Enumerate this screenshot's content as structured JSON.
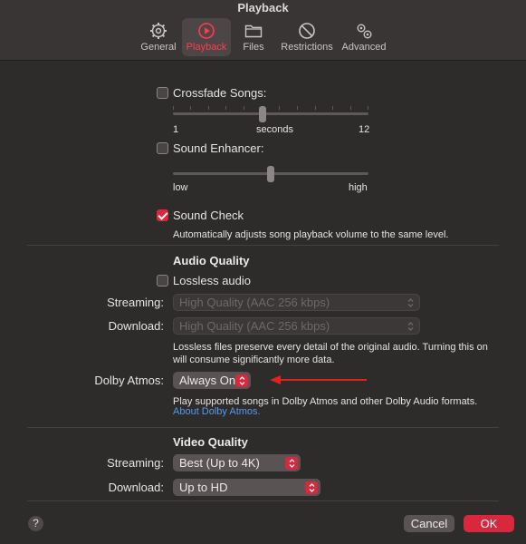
{
  "window": {
    "title": "Playback"
  },
  "tabs": [
    {
      "label": "General",
      "icon": "gear-icon"
    },
    {
      "label": "Playback",
      "icon": "play-circle-icon"
    },
    {
      "label": "Files",
      "icon": "folder-icon"
    },
    {
      "label": "Restrictions",
      "icon": "no-entry-icon"
    },
    {
      "label": "Advanced",
      "icon": "gears-icon"
    }
  ],
  "crossfade": {
    "label": "Crossfade Songs:",
    "checked": false,
    "min_label": "1",
    "mid_label": "seconds",
    "max_label": "12",
    "value": 6,
    "min": 1,
    "max": 12
  },
  "enhancer": {
    "label": "Sound Enhancer:",
    "checked": false,
    "min_label": "low",
    "max_label": "high",
    "value_fraction": 0.5
  },
  "sound_check": {
    "label": "Sound Check",
    "checked": true,
    "description": "Automatically adjusts song playback volume to the same level."
  },
  "audio_quality": {
    "title": "Audio Quality",
    "lossless_label": "Lossless audio",
    "lossless_checked": false,
    "streaming_label": "Streaming:",
    "streaming_value": "High Quality (AAC 256 kbps)",
    "download_label": "Download:",
    "download_value": "High Quality (AAC 256 kbps)",
    "lossless_desc_line1": "Lossless files preserve every detail of the original audio. Turning this on",
    "lossless_desc_line2": "will consume significantly more data.",
    "dolby_label": "Dolby Atmos:",
    "dolby_value": "Always On",
    "dolby_desc": "Play supported songs in Dolby Atmos and other Dolby Audio formats.",
    "dolby_link": "About Dolby Atmos."
  },
  "video_quality": {
    "title": "Video Quality",
    "streaming_label": "Streaming:",
    "streaming_value": "Best (Up to 4K)",
    "download_label": "Download:",
    "download_value": "Up to HD"
  },
  "footer": {
    "help_label": "?",
    "cancel_label": "Cancel",
    "ok_label": "OK"
  },
  "colors": {
    "accent": "#d9283d",
    "active_tab_text": "#ff3b4f",
    "link": "#4e9cf5",
    "arrow": "#e0231e"
  }
}
